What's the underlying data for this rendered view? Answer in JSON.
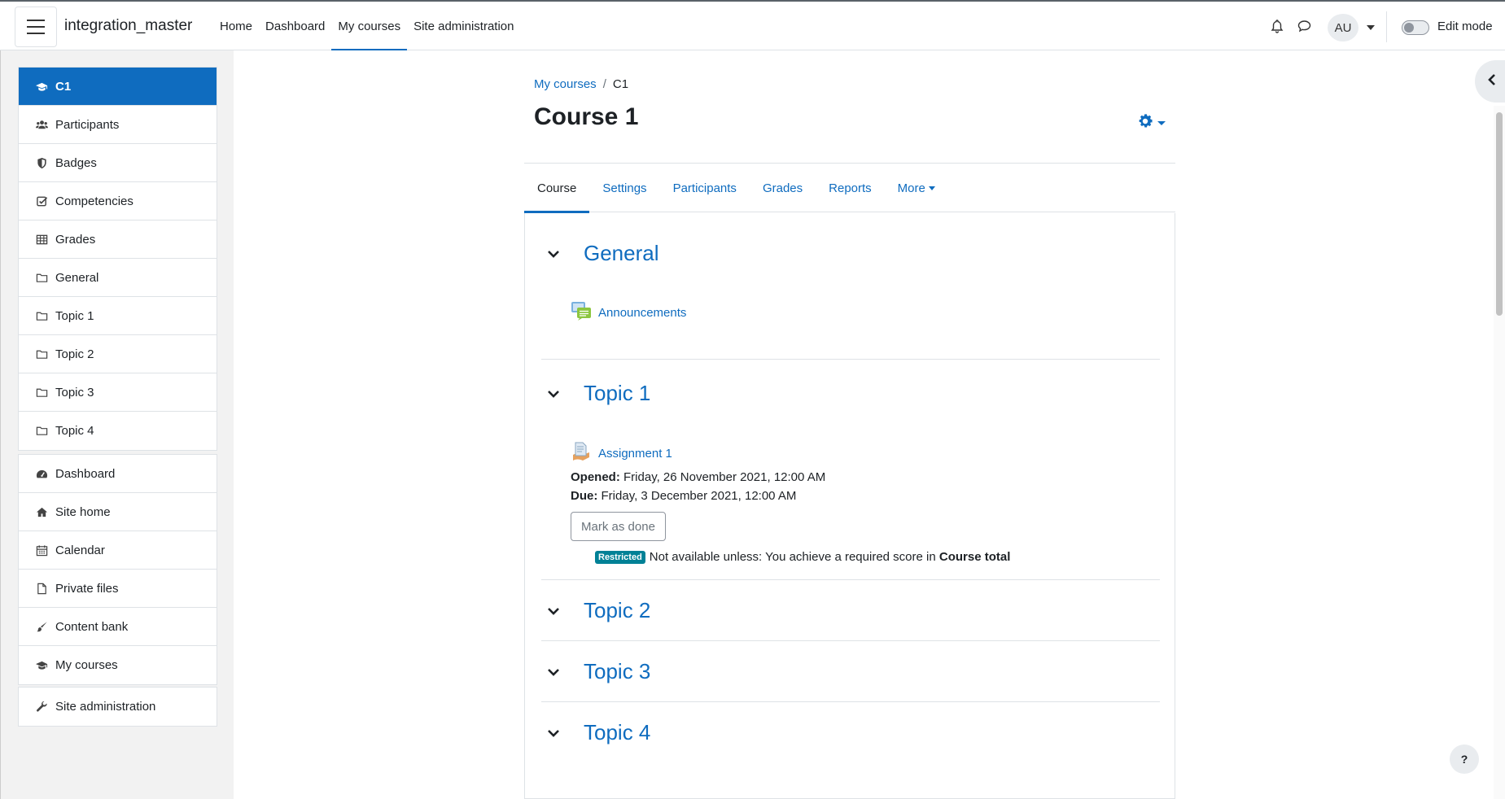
{
  "navbar": {
    "site_name": "integration_master",
    "menu": [
      {
        "label": "Home"
      },
      {
        "label": "Dashboard"
      },
      {
        "label": "My courses"
      },
      {
        "label": "Site administration"
      }
    ],
    "active_menu": "My courses",
    "avatar_initials": "AU",
    "edit_mode_label": "Edit mode"
  },
  "drawer": {
    "course_items": [
      {
        "label": "C1",
        "icon": "graduation-cap-icon",
        "active": true
      },
      {
        "label": "Participants",
        "icon": "users-icon"
      },
      {
        "label": "Badges",
        "icon": "shield-icon"
      },
      {
        "label": "Competencies",
        "icon": "check-square-icon"
      },
      {
        "label": "Grades",
        "icon": "table-icon"
      },
      {
        "label": "General",
        "icon": "folder-icon"
      },
      {
        "label": "Topic 1",
        "icon": "folder-icon"
      },
      {
        "label": "Topic 2",
        "icon": "folder-icon"
      },
      {
        "label": "Topic 3",
        "icon": "folder-icon"
      },
      {
        "label": "Topic 4",
        "icon": "folder-icon"
      }
    ],
    "site_items": [
      {
        "label": "Dashboard",
        "icon": "tachometer-icon"
      },
      {
        "label": "Site home",
        "icon": "home-icon"
      },
      {
        "label": "Calendar",
        "icon": "calendar-icon"
      },
      {
        "label": "Private files",
        "icon": "file-icon"
      },
      {
        "label": "Content bank",
        "icon": "paint-brush-icon"
      },
      {
        "label": "My courses",
        "icon": "graduation-cap-icon"
      }
    ],
    "admin_items": [
      {
        "label": "Site administration",
        "icon": "wrench-icon"
      }
    ]
  },
  "breadcrumb": {
    "items": [
      {
        "label": "My courses"
      },
      {
        "label": "C1"
      }
    ],
    "separator": "/"
  },
  "page": {
    "title": "Course 1"
  },
  "secondary_nav": {
    "tabs": [
      {
        "label": "Course",
        "active": true
      },
      {
        "label": "Settings"
      },
      {
        "label": "Participants"
      },
      {
        "label": "Grades"
      },
      {
        "label": "Reports"
      },
      {
        "label": "More"
      }
    ]
  },
  "sections": [
    {
      "title": "General",
      "activities": [
        {
          "name": "Announcements",
          "icon": "forum-icon"
        }
      ]
    },
    {
      "title": "Topic 1",
      "activities": [
        {
          "name": "Assignment 1",
          "icon": "assignment-icon",
          "opened_label": "Opened:",
          "opened_value": "Friday, 26 November 2021, 12:00 AM",
          "due_label": "Due:",
          "due_value": "Friday, 3 December 2021, 12:00 AM",
          "button": "Mark as done",
          "restriction_badge": "Restricted",
          "restriction_text": "Not available unless: You achieve a required score in",
          "restriction_bold": "Course total"
        }
      ]
    },
    {
      "title": "Topic 2"
    },
    {
      "title": "Topic 3"
    },
    {
      "title": "Topic 4"
    }
  ],
  "help_button": "?",
  "colors": {
    "primary": "#0f6cbf",
    "badge": "#008196",
    "drawer_bg": "#f2f2f2"
  }
}
